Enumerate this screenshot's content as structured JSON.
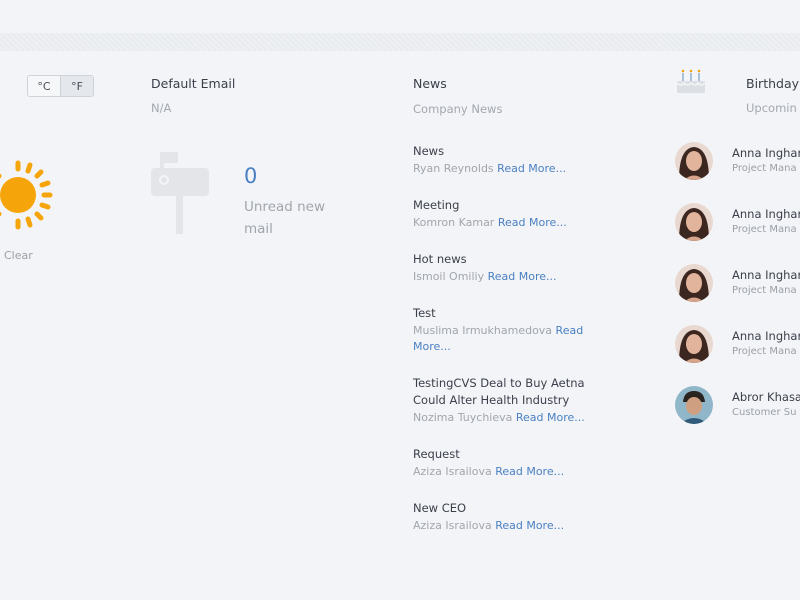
{
  "weather": {
    "units": [
      "°C",
      "°F"
    ],
    "active_unit": "°F",
    "condition": "Clear",
    "icon": "sun-icon",
    "sun_color": "#f5a50a"
  },
  "email": {
    "title": "Default Email",
    "value": "N/A",
    "unread_count": "0",
    "unread_label": "Unread new mail",
    "icon": "mailbox-icon"
  },
  "news": {
    "title": "News",
    "subtitle": "Company News",
    "read_more": "Read More...",
    "items": [
      {
        "title": "News",
        "author": "Ryan Reynolds"
      },
      {
        "title": "Meeting",
        "author": "Komron Kamar"
      },
      {
        "title": "Hot news",
        "author": "Ismoil Omiliy"
      },
      {
        "title": "Test",
        "author": "Muslima Irmukhamedova"
      },
      {
        "title": "TestingCVS Deal to Buy Aetna Could Alter Health Industry",
        "author": "Nozima Tuychieva"
      },
      {
        "title": "Request",
        "author": "Aziza Israilova"
      },
      {
        "title": "New CEO",
        "author": "Aziza Israilova"
      }
    ]
  },
  "birthdays": {
    "title": "Birthday",
    "subtitle": "Upcomin",
    "icon": "cake-icon",
    "people": [
      {
        "name": "Anna Inghar",
        "role": "Project Mana"
      },
      {
        "name": "Anna Inghar",
        "role": "Project Mana"
      },
      {
        "name": "Anna Inghar",
        "role": "Project Mana"
      },
      {
        "name": "Anna Inghar",
        "role": "Project Mana"
      },
      {
        "name": "Abror Khasa",
        "role": "Customer Su"
      }
    ]
  },
  "colors": {
    "accent": "#4a80c2",
    "background": "#f3f4f7",
    "muted_text": "#a3a8b0"
  }
}
